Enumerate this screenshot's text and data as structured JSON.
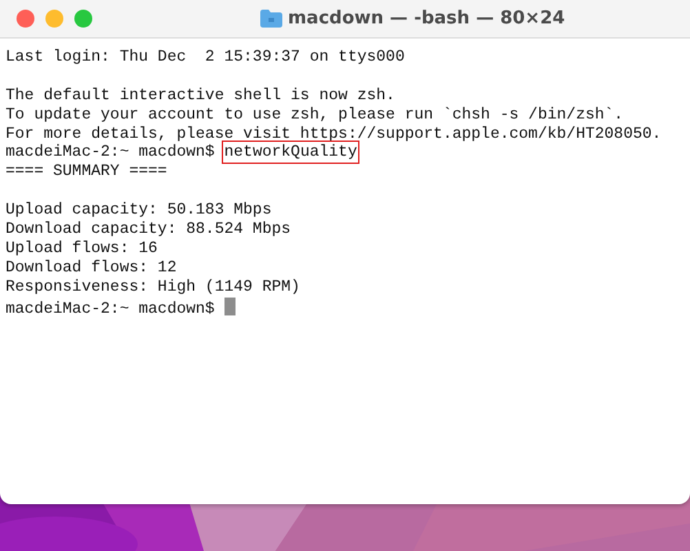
{
  "window": {
    "title": "macdown — -bash — 80×24"
  },
  "terminal": {
    "lines": [
      {
        "kind": "output",
        "text": "Last login: Thu Dec  2 15:39:37 on ttys000"
      },
      {
        "kind": "blank"
      },
      {
        "kind": "output",
        "text": "The default interactive shell is now zsh."
      },
      {
        "kind": "output",
        "text": "To update your account to use zsh, please run `chsh -s /bin/zsh`."
      },
      {
        "kind": "output",
        "text": "For more details, please visit https://support.apple.com/kb/HT208050."
      },
      {
        "kind": "prompt",
        "prompt": "macdeiMac-2:~ macdown$",
        "command": "networkQuality",
        "highlighted": true,
        "cursor": false
      },
      {
        "kind": "output",
        "text": "==== SUMMARY ===="
      },
      {
        "kind": "blank"
      },
      {
        "kind": "output",
        "text": "Upload capacity: 50.183 Mbps"
      },
      {
        "kind": "output",
        "text": "Download capacity: 88.524 Mbps"
      },
      {
        "kind": "output",
        "text": "Upload flows: 16"
      },
      {
        "kind": "output",
        "text": "Download flows: 12"
      },
      {
        "kind": "output",
        "text": "Responsiveness: High (1149 RPM)"
      },
      {
        "kind": "prompt",
        "prompt": "macdeiMac-2:~ macdown$",
        "cursor": true
      }
    ]
  }
}
